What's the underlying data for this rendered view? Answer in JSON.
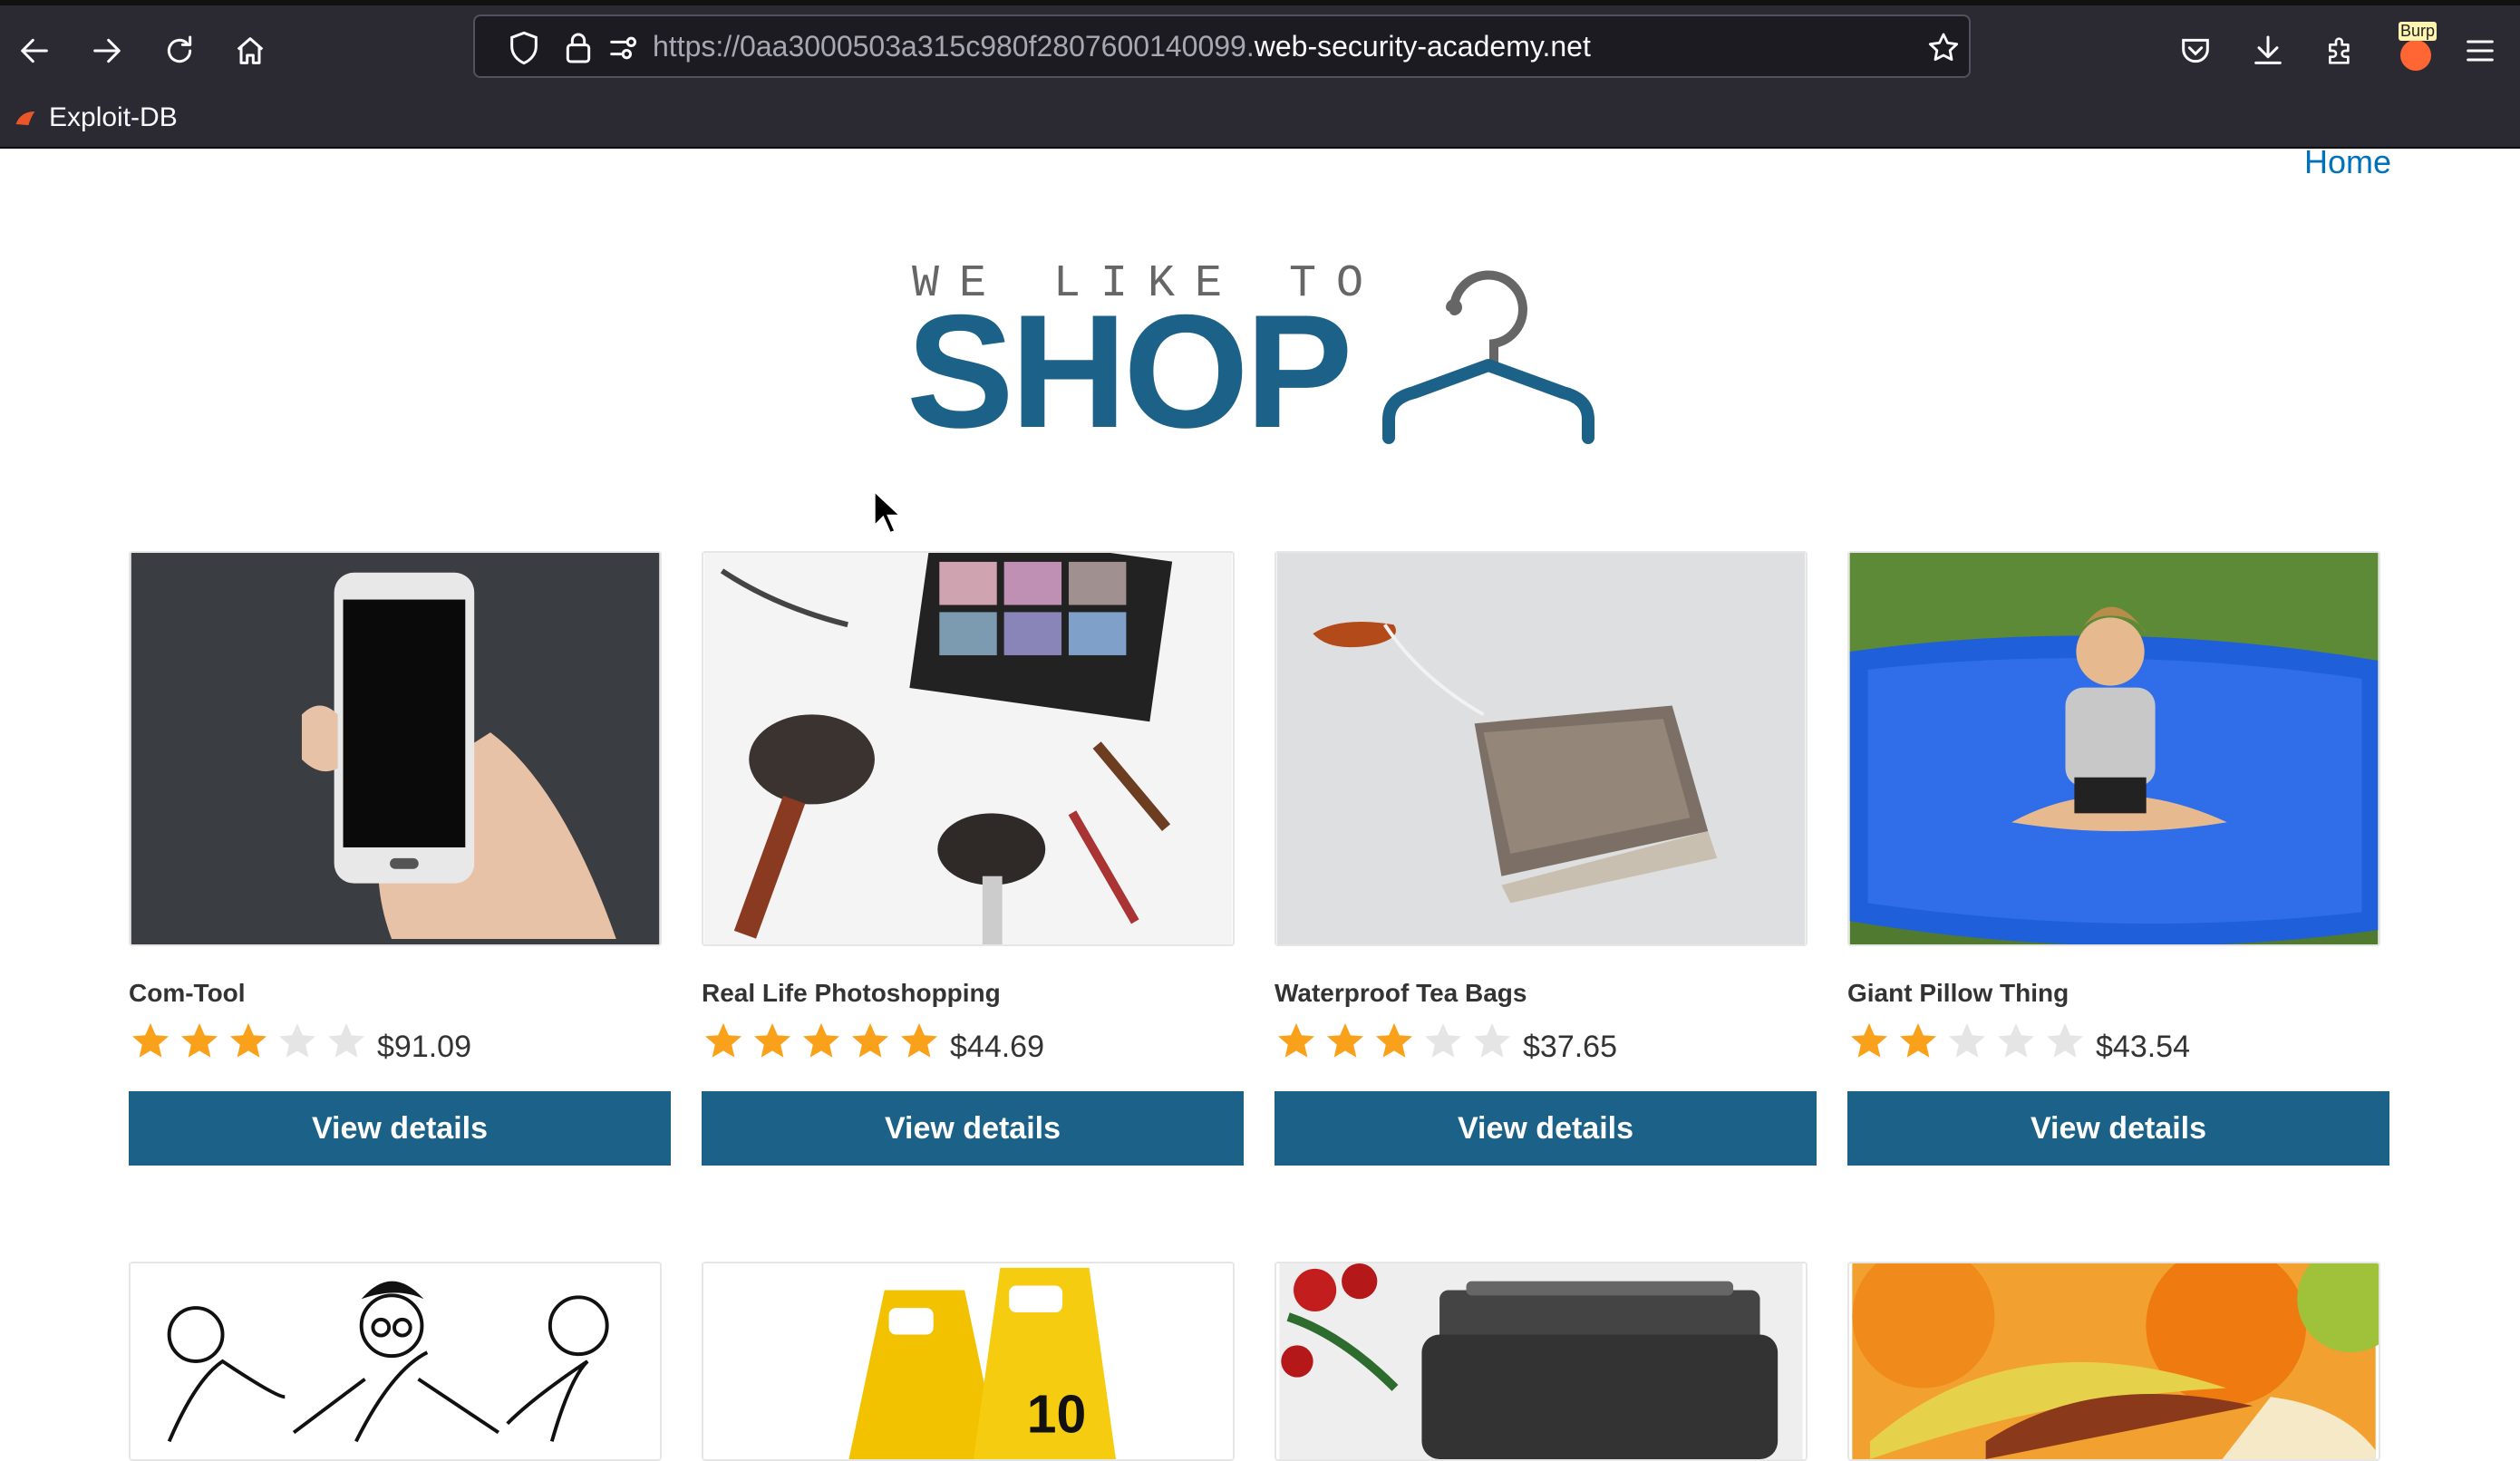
{
  "browser": {
    "url_prefix": "https://0aa3000503a315c980f2807600140099.",
    "url_domain": "web-security-academy.net",
    "bookmarks": [
      {
        "label": "Exploit-DB"
      }
    ],
    "extension_badge": "Burp"
  },
  "nav": {
    "home_label": "Home"
  },
  "logo": {
    "tagline": "WE LIKE TO",
    "word": "SHOP"
  },
  "colors": {
    "brand": "#1c6187",
    "link": "#0071bc",
    "star": "#f9a11a",
    "star_empty": "#e5e5e5"
  },
  "products": [
    {
      "name": "Com-Tool",
      "rating": 3,
      "max_rating": 5,
      "price": "$91.09",
      "button": "View details"
    },
    {
      "name": "Real Life Photoshopping",
      "rating": 5,
      "max_rating": 5,
      "price": "$44.69",
      "button": "View details"
    },
    {
      "name": "Waterproof Tea Bags",
      "rating": 3,
      "max_rating": 5,
      "price": "$37.65",
      "button": "View details"
    },
    {
      "name": "Giant Pillow Thing",
      "rating": 2,
      "max_rating": 5,
      "price": "$43.54",
      "button": "View details"
    }
  ]
}
